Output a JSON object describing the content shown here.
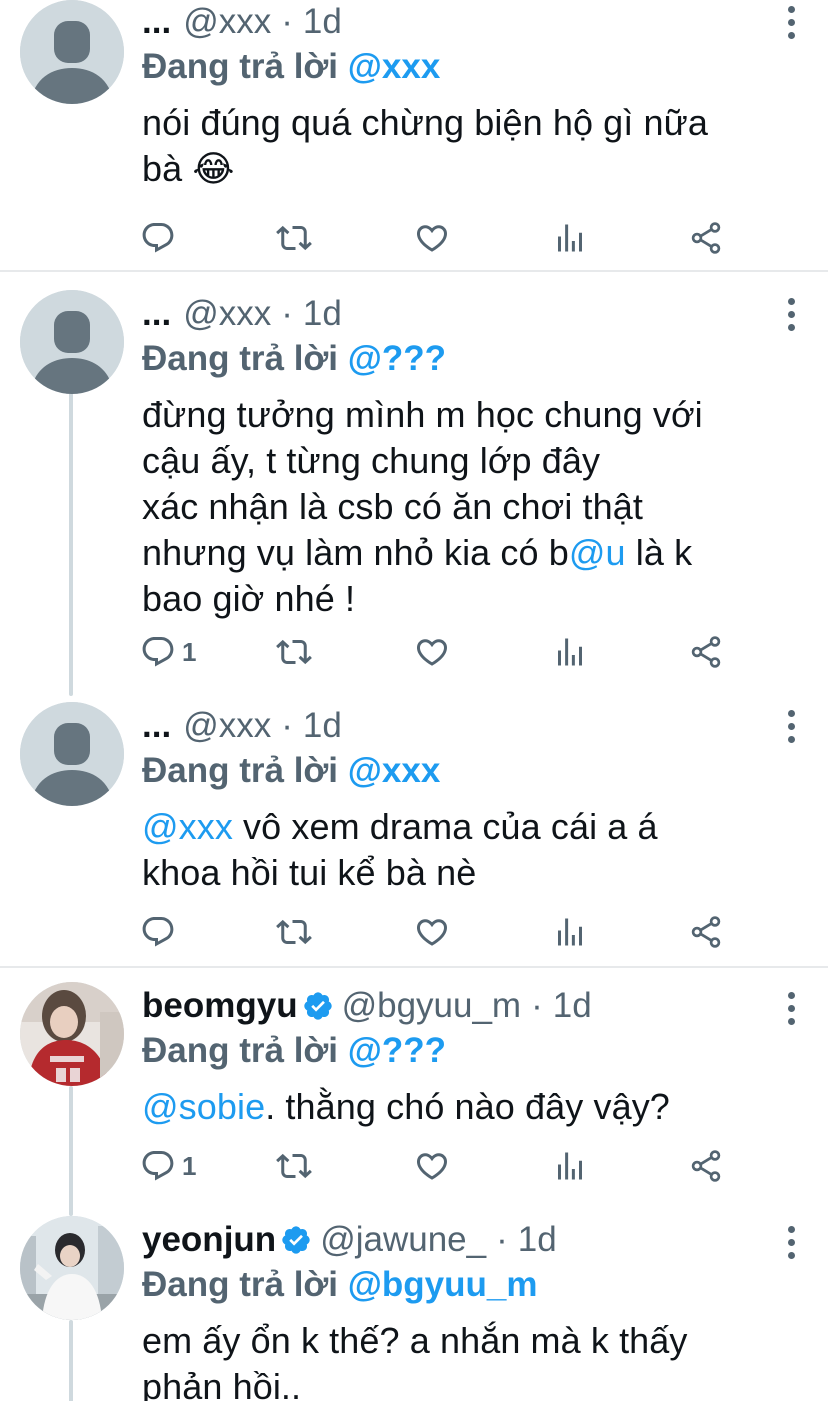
{
  "reply_prefix": "Đang trả lời",
  "tweets": [
    {
      "name": "...",
      "handle": "@xxx",
      "dot": "·",
      "time": "1d",
      "replying_to": "@xxx",
      "text": "nói đúng quá chừng biện hộ gì nữa bà 😂",
      "reply_count": ""
    },
    {
      "name": "...",
      "handle": "@xxx",
      "dot": "·",
      "time": "1d",
      "replying_to": "@???",
      "text_lines": [
        "đừng tưởng mình m học chung với",
        "cậu ấy, t từng chung lớp đây",
        "xác nhận là csb có ăn chơi thật"
      ],
      "text_line4_before": "nhưng vụ làm nhỏ kia có b",
      "text_line4_mention": "@u",
      "text_line4_after": " là k",
      "text_line5": "bao giờ nhé !",
      "reply_count": "1"
    },
    {
      "name": "...",
      "handle": "@xxx",
      "dot": "·",
      "time": "1d",
      "replying_to": "@xxx",
      "text_mention": "@xxx",
      "text_line1_rest": " vô xem drama của cái a á",
      "text_line2": "khoa hồi tui kể bà nè",
      "reply_count": ""
    },
    {
      "name": "beomgyu",
      "handle": "@bgyuu_m",
      "dot": "·",
      "time": "1d",
      "replying_to": "@???",
      "text_mention": "@sobie",
      "text_rest": ". thằng chó nào đây vậy?",
      "reply_count": "1"
    },
    {
      "name": "yeonjun",
      "handle": "@jawune_",
      "dot": "·",
      "time": "1d",
      "replying_to": "@bgyuu_m",
      "text_line1": "em ấy ổn k thế? a nhắn mà k thấy",
      "text_line2": "phản hồi.."
    }
  ],
  "icons": {
    "reply": "reply-icon",
    "retweet": "retweet-icon",
    "like": "heart-icon",
    "views": "views-icon",
    "share": "share-icon",
    "more": "more-options-icon",
    "verified": "verified-badge-icon"
  },
  "colors": {
    "text": "#0f1419",
    "secondary": "#536471",
    "accent": "#1d9bf0",
    "divider": "#e7e9eb",
    "thread": "#cfd9de"
  }
}
